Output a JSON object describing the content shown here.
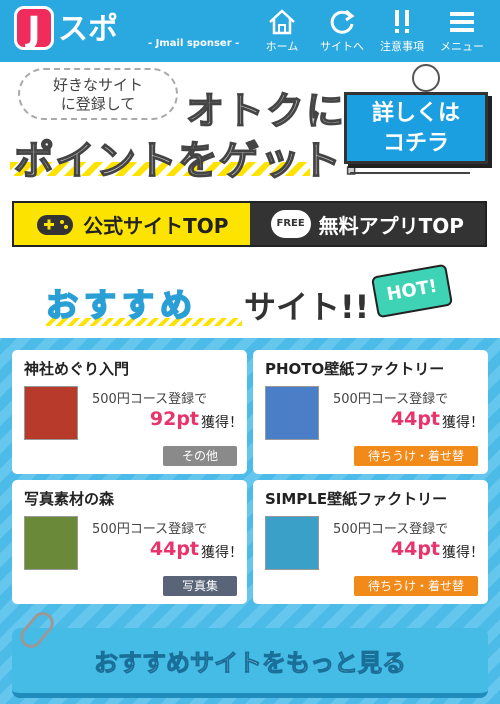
{
  "header": {
    "logo_j": "J",
    "logo_word": "スポ",
    "logo_sub": "- Jmail sponser -",
    "nav": [
      {
        "label": "ホーム",
        "icon": "home-icon"
      },
      {
        "label": "サイトへ",
        "icon": "refresh-icon"
      },
      {
        "label": "注意事項",
        "icon": "exclamation-icon"
      },
      {
        "label": "メニュー",
        "icon": "menu-icon"
      }
    ]
  },
  "banner": {
    "bubble_line1": "好きなサイト",
    "bubble_line2": "に登録して",
    "big_line1": "オトクに",
    "big_line2": "ポイントをゲット!",
    "cta_line1": "詳しくは",
    "cta_line2": "コチラ"
  },
  "top_buttons": {
    "official": "公式サイトTOP",
    "free_badge": "FREE",
    "free_apps": "無料アプリTOP"
  },
  "recommend": {
    "title_part1": "おすすめ",
    "title_part2": "サイト!!",
    "hot": "HOT!"
  },
  "cards": [
    {
      "title": "神社めぐり入門",
      "line": "500円コース登録で",
      "pt": "92pt",
      "get": "獲得！",
      "tag": "その他",
      "thumb_color": "#b83a2a"
    },
    {
      "title": "PHOTO壁紙ファクトリー",
      "line": "500円コース登録で",
      "pt": "44pt",
      "get": "獲得！",
      "tag": "待ちうけ・着せ替",
      "thumb_color": "#4a7fc8"
    },
    {
      "title": "写真素材の森",
      "line": "500円コース登録で",
      "pt": "44pt",
      "get": "獲得！",
      "tag": "写真集",
      "thumb_color": "#6a8a3a"
    },
    {
      "title": "SIMPLE壁紙ファクトリー",
      "line": "500円コース登録で",
      "pt": "44pt",
      "get": "獲得！",
      "tag": "待ちうけ・着せ替",
      "thumb_color": "#3aa0c8"
    }
  ],
  "more_button": "おすすめサイトをもっと見る"
}
